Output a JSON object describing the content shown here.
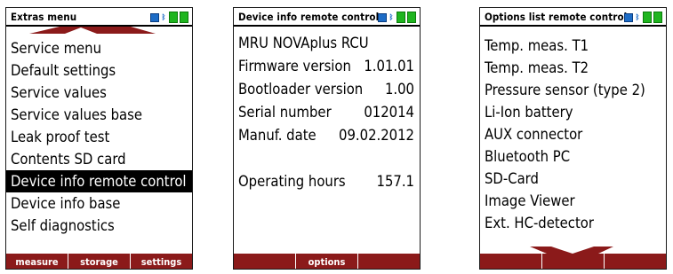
{
  "screens": [
    {
      "title": "Extras menu",
      "items": [
        "Service menu",
        "Default settings",
        "Service values",
        "Service values base",
        "Leak proof test",
        "Contents SD card",
        "Device info remote control",
        "Device info base",
        "Self diagnostics"
      ],
      "selected_index": 6,
      "softkeys": [
        "measure",
        "storage",
        "settings"
      ]
    },
    {
      "title": "Device info remote control",
      "heading": "MRU NOVAplus RCU",
      "rows": [
        {
          "label": "Firmware version",
          "value": "1.01.01"
        },
        {
          "label": "Bootloader version",
          "value": "1.00"
        },
        {
          "label": "Serial number",
          "value": "012014"
        },
        {
          "label": "Manuf. date",
          "value": "09.02.2012"
        }
      ],
      "hours": {
        "label": "Operating hours",
        "value": "157.1"
      },
      "softkeys": [
        "",
        "options",
        ""
      ]
    },
    {
      "title": "Options list remote control",
      "items": [
        "Temp. meas. T1",
        "Temp. meas. T2",
        "Pressure sensor (type 2)",
        "Li-Ion battery",
        "AUX connector",
        "Bluetooth PC",
        "SD-Card",
        "Image Viewer",
        "Ext. HC-detector"
      ],
      "softkeys": [
        "",
        "",
        ""
      ]
    }
  ],
  "colors": {
    "softkey_bar": "#8b1a1a",
    "link_icon": "#1d6cc6",
    "battery_icon": "#1fb51f"
  },
  "icons": [
    "link-icon",
    "bluetooth-icon",
    "battery-icon",
    "scroll-up-arrow-icon",
    "scroll-down-arrow-icon"
  ]
}
